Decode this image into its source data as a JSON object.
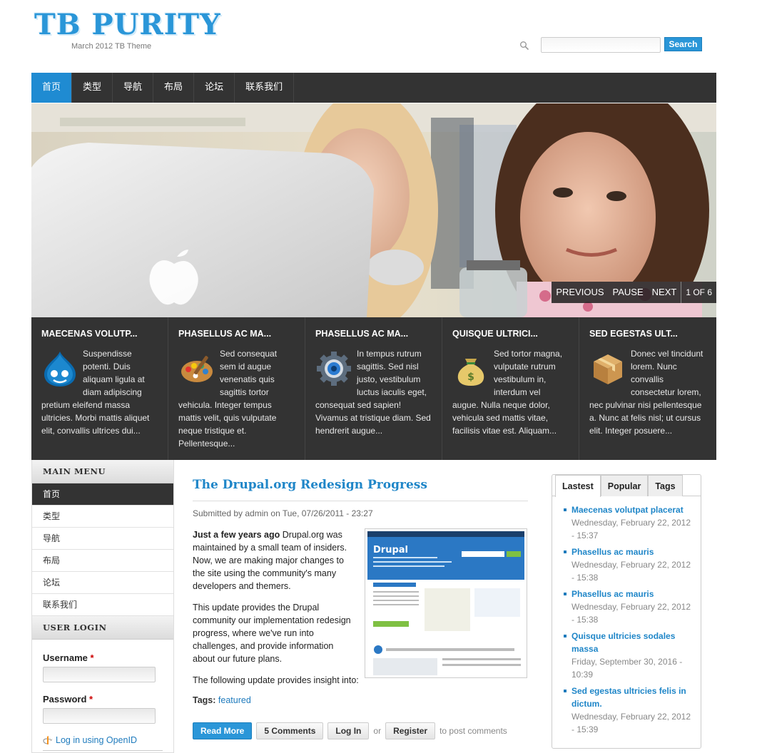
{
  "header": {
    "site_name": "TB PURITY",
    "slogan": "March 2012 TB Theme",
    "search_button": "Search",
    "search_placeholder": ""
  },
  "nav": {
    "items": [
      {
        "label": "首页",
        "active": true
      },
      {
        "label": "类型"
      },
      {
        "label": "导航"
      },
      {
        "label": "布局"
      },
      {
        "label": "论坛"
      },
      {
        "label": "联系我们"
      }
    ]
  },
  "slideshow": {
    "previous": "PREVIOUS",
    "pause": "PAUSE",
    "next": "NEXT",
    "counter": "1 OF 6"
  },
  "features": [
    {
      "title": "MAECENAS VOLUTP...",
      "icon": "drupal-drop-icon",
      "text": "Suspendisse potenti. Duis aliquam ligula at diam adipiscing pretium eleifend massa ultricies. Morbi mattis aliquet elit, convallis ultrices dui..."
    },
    {
      "title": "PHASELLUS AC MA...",
      "icon": "paint-palette-icon",
      "text": "Sed consequat sem id augue venenatis quis sagittis tortor vehicula. Integer tempus mattis velit, quis vulputate neque tristique et. Pellentesque..."
    },
    {
      "title": "PHASELLUS AC MA...",
      "icon": "gear-icon",
      "text": "In tempus rutrum sagittis. Sed nisl justo, vestibulum luctus iaculis eget, consequat sed sapien! Vivamus at tristique diam. Sed hendrerit augue..."
    },
    {
      "title": "QUISQUE ULTRICI...",
      "icon": "money-bag-icon",
      "text": "Sed tortor magna, vulputate rutrum vestibulum in, interdum vel augue. Nulla neque dolor, vehicula sed mattis vitae, facilisis vitae est. Aliquam..."
    },
    {
      "title": "SED EGESTAS ULT...",
      "icon": "package-box-icon",
      "text": "Donec vel tincidunt lorem. Nunc convallis consectetur lorem, nec pulvinar nisi pellentesque a. Nunc at felis nisl; ut cursus elit. Integer posuere..."
    }
  ],
  "main_menu": {
    "title": "MAIN MENU",
    "items": [
      {
        "label": "首页",
        "active": true
      },
      {
        "label": "类型"
      },
      {
        "label": "导航"
      },
      {
        "label": "布局"
      },
      {
        "label": "论坛"
      },
      {
        "label": "联系我们"
      }
    ]
  },
  "user_login": {
    "title": "USER LOGIN",
    "username_label": "Username",
    "password_label": "Password",
    "required_mark": "*",
    "openid_link": "Log in using OpenID"
  },
  "node": {
    "title": "The Drupal.org Redesign Progress",
    "submitted": "Submitted by admin on Tue, 07/26/2011 - 23:27",
    "lead_bold": "Just a few years ago",
    "lead_rest": " Drupal.org was maintained by a small team of insiders. Now, we are making major changes to the site using the community's many developers and themers.",
    "para2": "This update provides the Drupal community our implementation redesign progress, where we've run into challenges, and provide information about our future plans.",
    "para3": "The following update provides insight into:",
    "tags_label": "Tags:",
    "tag": "featured",
    "links": {
      "read_more": "Read More",
      "comments": "5 Comments",
      "login": "Log In",
      "or": "or",
      "register": "Register",
      "to_post": "to post comments"
    }
  },
  "tabs": {
    "items": [
      {
        "label": "Lastest",
        "active": true
      },
      {
        "label": "Popular"
      },
      {
        "label": "Tags"
      }
    ],
    "latest": [
      {
        "title": "Maecenas volutpat placerat",
        "date": "Wednesday, February 22, 2012 - 15:37"
      },
      {
        "title": "Phasellus ac mauris",
        "date": "Wednesday, February 22, 2012 - 15:38"
      },
      {
        "title": "Phasellus ac mauris",
        "date": "Wednesday, February 22, 2012 - 15:38"
      },
      {
        "title": "Quisque ultricies sodales massa",
        "date": "Friday, September 30, 2016 - 10:39"
      },
      {
        "title": "Sed egestas ultricies felis in dictum.",
        "date": "Wednesday, February 22, 2012 - 15:39"
      }
    ]
  },
  "colors": {
    "accent": "#2a96d8",
    "nav_bg": "#333333",
    "link": "#1f86c8"
  }
}
